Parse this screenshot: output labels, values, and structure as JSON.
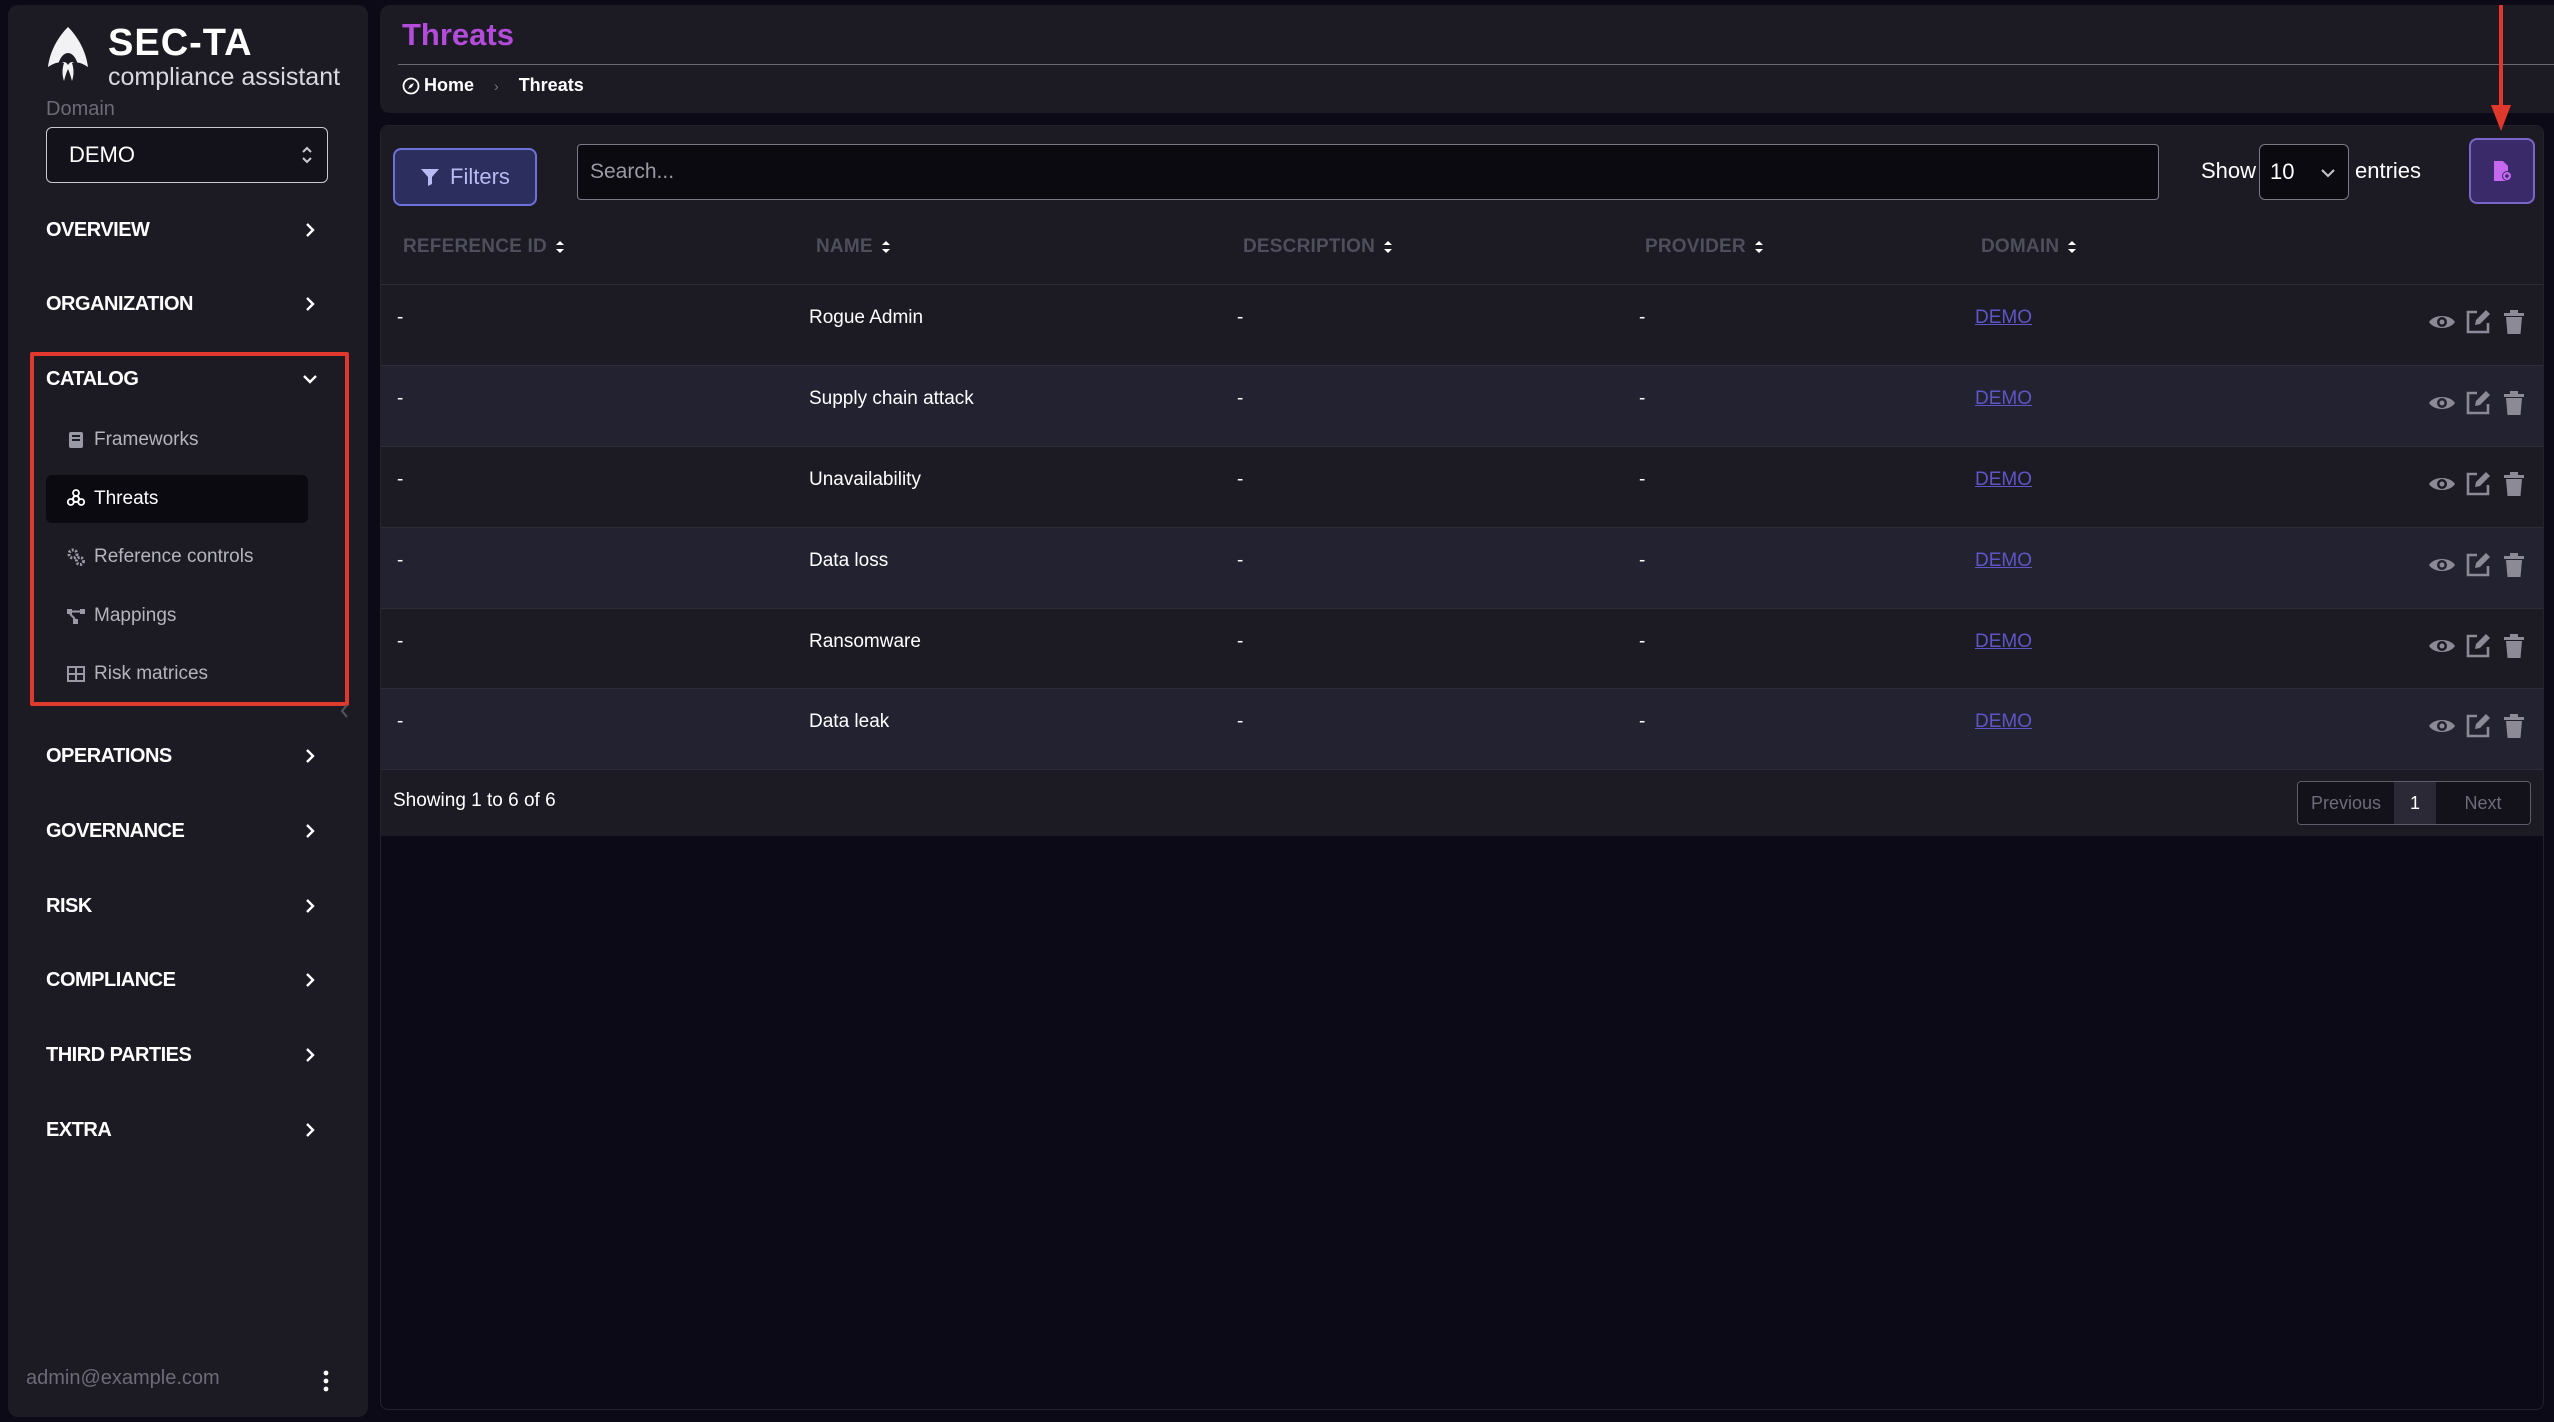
{
  "brand": {
    "title": "SEC-TA",
    "subtitle": "compliance assistant"
  },
  "domain": {
    "label": "Domain",
    "value": "DEMO"
  },
  "nav": {
    "overview": "OVERVIEW",
    "organization": "ORGANIZATION",
    "catalog": "CATALOG",
    "operations": "OPERATIONS",
    "governance": "GOVERNANCE",
    "risk": "RISK",
    "compliance": "COMPLIANCE",
    "third_parties": "THIRD PARTIES",
    "extra": "EXTRA"
  },
  "catalog_items": {
    "frameworks": "Frameworks",
    "threats": "Threats",
    "reference_controls": "Reference controls",
    "mappings": "Mappings",
    "risk_matrices": "Risk matrices"
  },
  "user": {
    "email": "admin@example.com"
  },
  "header": {
    "title": "Threats",
    "breadcrumb": {
      "home": "Home",
      "current": "Threats"
    }
  },
  "toolbar": {
    "filters": "Filters",
    "search_placeholder": "Search...",
    "show": "Show",
    "entries_value": "10",
    "entries": "entries"
  },
  "table": {
    "headers": {
      "ref_id": "REFERENCE ID",
      "name": "NAME",
      "description": "DESCRIPTION",
      "provider": "PROVIDER",
      "domain": "DOMAIN"
    },
    "rows": [
      {
        "ref_id": "-",
        "name": "Rogue Admin",
        "description": "-",
        "provider": "-",
        "domain": "DEMO"
      },
      {
        "ref_id": "-",
        "name": "Supply chain attack",
        "description": "-",
        "provider": "-",
        "domain": "DEMO"
      },
      {
        "ref_id": "-",
        "name": "Unavailability",
        "description": "-",
        "provider": "-",
        "domain": "DEMO"
      },
      {
        "ref_id": "-",
        "name": "Data loss",
        "description": "-",
        "provider": "-",
        "domain": "DEMO"
      },
      {
        "ref_id": "-",
        "name": "Ransomware",
        "description": "-",
        "provider": "-",
        "domain": "DEMO"
      },
      {
        "ref_id": "-",
        "name": "Data leak",
        "description": "-",
        "provider": "-",
        "domain": "DEMO"
      }
    ]
  },
  "footer": {
    "showing": "Showing 1 to 6 of 6",
    "previous": "Previous",
    "page": "1",
    "next": "Next"
  },
  "colors": {
    "accent": "#b44cdb",
    "annotation": "#e0382d",
    "link": "#5e55c6"
  }
}
